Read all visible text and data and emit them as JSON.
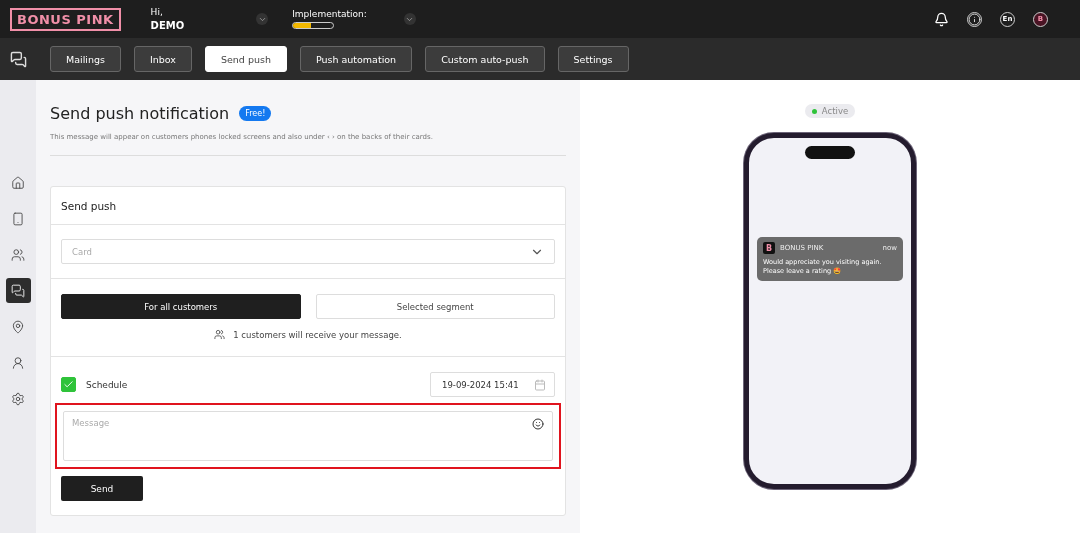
{
  "header": {
    "logo": "BONUS PINK",
    "greeting": "Hi,",
    "user": "DEMO",
    "implementation": {
      "label": "Implementation:",
      "level": 0.45
    },
    "language": "En",
    "avatar": "B"
  },
  "tabs": [
    {
      "label": "Mailings",
      "selected": false
    },
    {
      "label": "Inbox",
      "selected": false
    },
    {
      "label": "Send push",
      "selected": true
    },
    {
      "label": "Push automation",
      "selected": false
    },
    {
      "label": "Custom auto-push",
      "selected": false
    },
    {
      "label": "Settings",
      "selected": false
    }
  ],
  "sidebar": {
    "items": [
      {
        "kind": "home",
        "selected": false
      },
      {
        "kind": "phone",
        "selected": false
      },
      {
        "kind": "users",
        "selected": false
      },
      {
        "kind": "chat",
        "selected": true
      },
      {
        "kind": "pin",
        "selected": false
      },
      {
        "kind": "user",
        "selected": false
      },
      {
        "kind": "settings",
        "selected": false
      }
    ]
  },
  "page": {
    "title": "Send push notification",
    "badge": "Free!",
    "description": "This message will appear on customers phones locked screens and also under ‹ › on the backs of their cards."
  },
  "form": {
    "title": "Send push",
    "card_select": {
      "placeholder": "Card"
    },
    "audience": [
      {
        "label": "For all customers",
        "selected": true
      },
      {
        "label": "Selected segment",
        "selected": false
      }
    ],
    "recipients_info": "1 customers will receive your message.",
    "schedule": {
      "label": "Schedule",
      "checked": true,
      "date": "19-09-2024 15:41"
    },
    "message": {
      "placeholder": "Message",
      "highlighted": true
    },
    "send_button": "Send"
  },
  "preview": {
    "status": {
      "label": "Active",
      "active": true
    },
    "notification": {
      "app": "BONUS PINK",
      "app_icon": "B",
      "time": "now",
      "text": "Would appreciate you visiting again. Please leave a rating 🤩"
    }
  }
}
